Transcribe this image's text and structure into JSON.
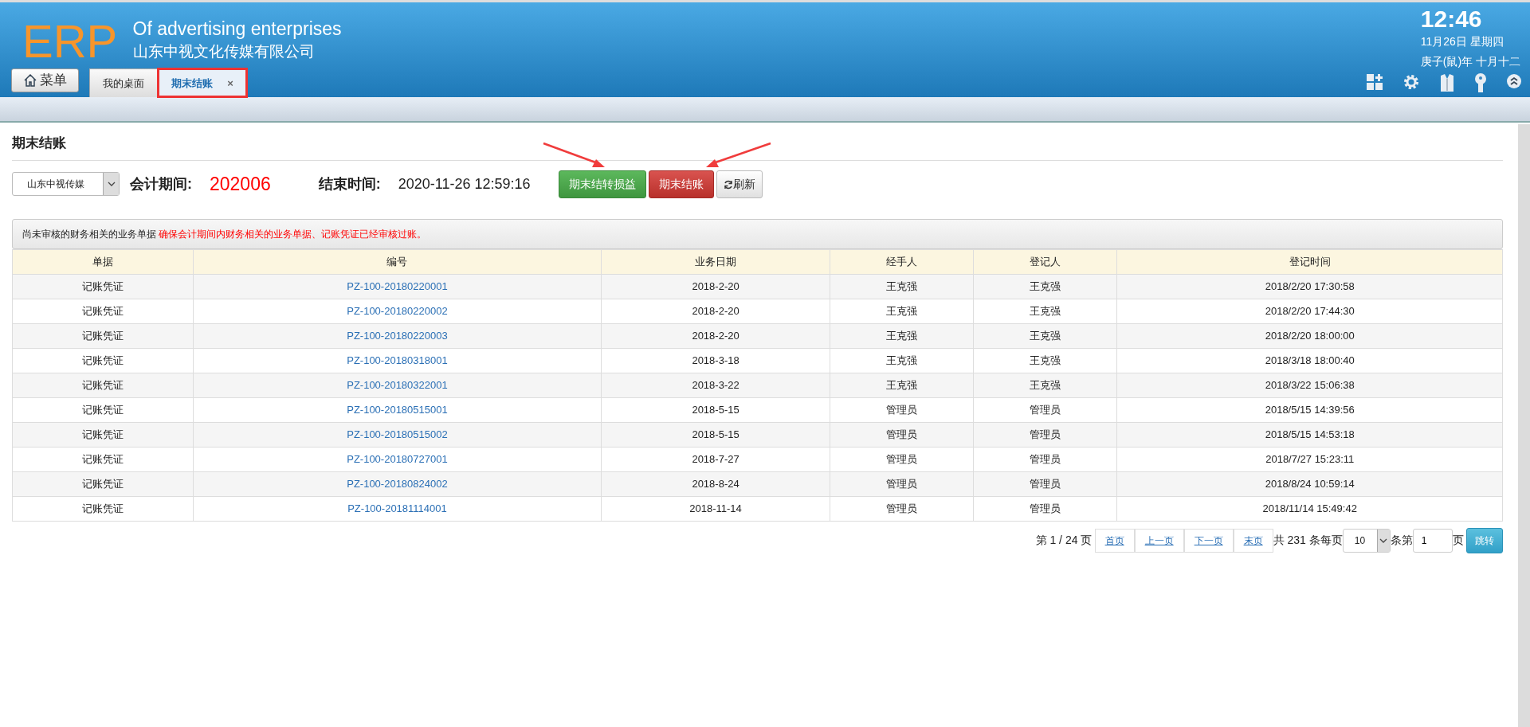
{
  "header": {
    "logo": "ERP",
    "subtitle": "Of advertising enterprises",
    "company": "山东中视文化传媒有限公司",
    "time": "12:46",
    "date": "11月26日 星期四",
    "lunar": "庚子(鼠)年 十月十二",
    "menu_button": "菜单"
  },
  "tabs": [
    {
      "label": "我的桌面",
      "selected": false,
      "closable": false
    },
    {
      "label": "期末结账",
      "selected": true,
      "closable": true,
      "close": "×"
    }
  ],
  "page": {
    "title": "期末结账",
    "company_select": "山东中视传媒",
    "period_label": "会计期间:",
    "period": "202006",
    "end_label": "结束时间:",
    "end_time": "2020-11-26 12:59:16",
    "buttons": [
      {
        "label": "期末结转损益",
        "kind": "success"
      },
      {
        "label": "期末结账",
        "kind": "danger"
      },
      {
        "label": "刷新",
        "kind": "refresh"
      }
    ]
  },
  "notice": {
    "text": "尚未审核的财务相关的业务单据",
    "warning": "确保会计期间内财务相关的业务单据、记账凭证已经审核过账。"
  },
  "table": {
    "columns": [
      "单据",
      "编号",
      "业务日期",
      "经手人",
      "登记人",
      "登记时间"
    ],
    "rows": [
      [
        "记账凭证",
        "PZ-100-20180220001",
        "2018-2-20",
        "王克强",
        "王克强",
        "2018/2/20 17:30:58"
      ],
      [
        "记账凭证",
        "PZ-100-20180220002",
        "2018-2-20",
        "王克强",
        "王克强",
        "2018/2/20 17:44:30"
      ],
      [
        "记账凭证",
        "PZ-100-20180220003",
        "2018-2-20",
        "王克强",
        "王克强",
        "2018/2/20 18:00:00"
      ],
      [
        "记账凭证",
        "PZ-100-20180318001",
        "2018-3-18",
        "王克强",
        "王克强",
        "2018/3/18 18:00:40"
      ],
      [
        "记账凭证",
        "PZ-100-20180322001",
        "2018-3-22",
        "王克强",
        "王克强",
        "2018/3/22 15:06:38"
      ],
      [
        "记账凭证",
        "PZ-100-20180515001",
        "2018-5-15",
        "管理员",
        "管理员",
        "2018/5/15 14:39:56"
      ],
      [
        "记账凭证",
        "PZ-100-20180515002",
        "2018-5-15",
        "管理员",
        "管理员",
        "2018/5/15 14:53:18"
      ],
      [
        "记账凭证",
        "PZ-100-20180727001",
        "2018-7-27",
        "管理员",
        "管理员",
        "2018/7/27 15:23:11"
      ],
      [
        "记账凭证",
        "PZ-100-20180824002",
        "2018-8-24",
        "管理员",
        "管理员",
        "2018/8/24 10:59:14"
      ],
      [
        "记账凭证",
        "PZ-100-20181114001",
        "2018-11-14",
        "管理员",
        "管理员",
        "2018/11/14 15:49:42"
      ]
    ]
  },
  "pagination": {
    "page_info": "第 1 / 24 页",
    "links": [
      "首页",
      "上一页",
      "下一页",
      "末页"
    ],
    "total": "共 231 条每页",
    "page_size": "10",
    "per_label": "条第",
    "page_input": "1",
    "page_suffix": "页",
    "go": "跳转"
  }
}
